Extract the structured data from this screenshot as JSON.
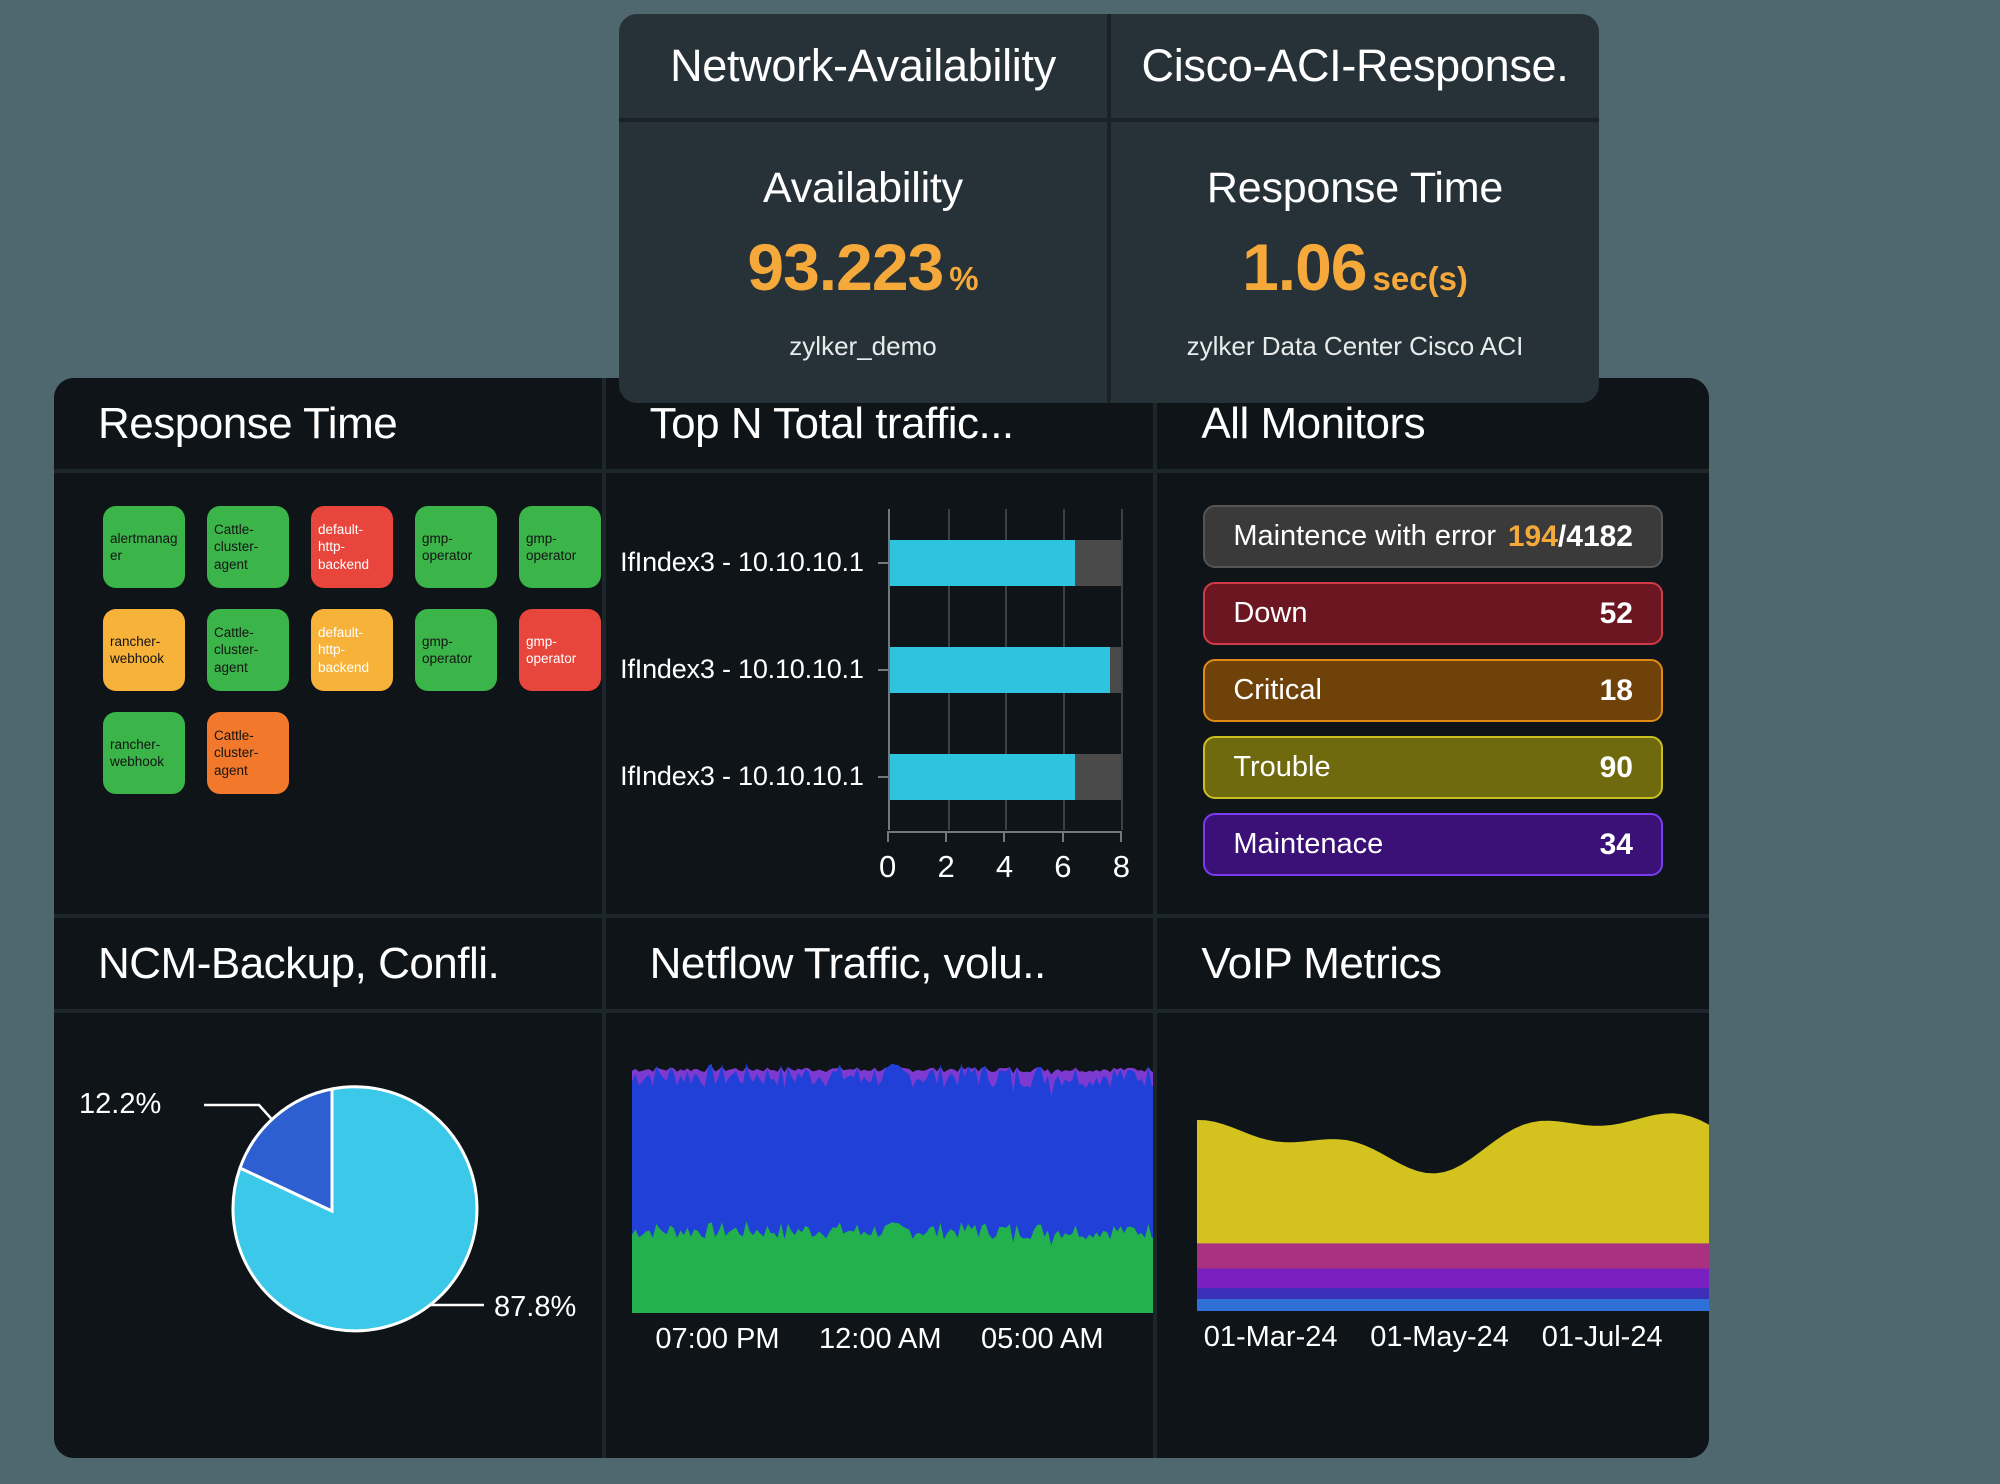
{
  "kpi_cards": [
    {
      "title": "Network-Availability",
      "metric": "Availability",
      "value": "93.223",
      "unit": "%",
      "subtitle": "zylker_demo"
    },
    {
      "title": "Cisco-ACI-Response.",
      "metric": "Response Time",
      "value": "1.06",
      "unit": "sec(s)",
      "subtitle": "zylker Data Center Cisco ACI"
    }
  ],
  "tiles": {
    "response_time": {
      "title": "Response Time",
      "badges": [
        {
          "label": "alertmanager",
          "color": "#3bb54a",
          "text": "dark"
        },
        {
          "label": "Cattle-cluster-agent",
          "color": "#3bb54a",
          "text": "dark"
        },
        {
          "label": "default-http-backend",
          "color": "#e8453c",
          "text": "light"
        },
        {
          "label": "gmp-operator",
          "color": "#3bb54a",
          "text": "dark"
        },
        {
          "label": "gmp-operator",
          "color": "#3bb54a",
          "text": "dark"
        },
        {
          "label": "rancher-webhook",
          "color": "#f7b239",
          "text": "dark"
        },
        {
          "label": "Cattle-cluster-agent",
          "color": "#3bb54a",
          "text": "dark"
        },
        {
          "label": "default-http-backend",
          "color": "#f7b239",
          "text": "light"
        },
        {
          "label": "gmp-operator",
          "color": "#3bb54a",
          "text": "dark"
        },
        {
          "label": "gmp-operator",
          "color": "#e8453c",
          "text": "light"
        },
        {
          "label": "rancher-webhook",
          "color": "#3bb54a",
          "text": "dark"
        },
        {
          "label": "Cattle-cluster-agent",
          "color": "#f2792b",
          "text": "dark"
        }
      ]
    },
    "top_n_traffic": {
      "title": "Top N Total traffic..."
    },
    "all_monitors": {
      "title": "All Monitors",
      "rows": [
        {
          "label": "Maintence with error",
          "value_accent": "194",
          "value_rest": "/4182",
          "bg": "#3a3a3a",
          "border": "#555555"
        },
        {
          "label": "Down",
          "value_accent": "",
          "value_rest": "52",
          "bg": "#6b1620",
          "border": "#d13b47"
        },
        {
          "label": "Critical",
          "value_accent": "",
          "value_rest": "18",
          "bg": "#6e4208",
          "border": "#e08b14"
        },
        {
          "label": "Trouble",
          "value_accent": "",
          "value_rest": "90",
          "bg": "#6f6a0d",
          "border": "#c9c020"
        },
        {
          "label": "Maintenace",
          "value_accent": "",
          "value_rest": "34",
          "bg": "#3b1178",
          "border": "#7a3cf0"
        }
      ]
    },
    "ncm_backup": {
      "title": "NCM-Backup, Confli."
    },
    "netflow": {
      "title": "Netflow Traffic, volu.."
    },
    "voip": {
      "title": "VoIP Metrics"
    }
  },
  "chart_data": [
    {
      "type": "bar",
      "title": "Top N Total traffic...",
      "orientation": "horizontal",
      "categories": [
        "IfIndex3 - 10.10.10.1",
        "IfIndex3 - 10.10.10.1",
        "IfIndex3 - 10.10.10.1"
      ],
      "values": [
        6.4,
        7.6,
        6.4
      ],
      "track_values": [
        8.0,
        8.0,
        8.0
      ],
      "xlabel": "",
      "ylabel": "",
      "xlim": [
        0,
        8
      ],
      "xticks": [
        0,
        2,
        4,
        6,
        8
      ],
      "tick_labels": [
        "0",
        "2",
        "4",
        "6",
        "8"
      ],
      "grid": true,
      "series_color": "#2ec4e0",
      "track_color": "#4a4a4a"
    },
    {
      "type": "pie",
      "title": "NCM-Backup, Confli.",
      "labels": [
        "12.2%",
        "87.8%"
      ],
      "values": [
        12.2,
        87.8
      ],
      "colors": [
        "#2e5fd0",
        "#3cc8e8"
      ],
      "label_positions": [
        "upper-left",
        "lower-right"
      ]
    },
    {
      "type": "area",
      "title": "Netflow Traffic, volu..",
      "stacked": true,
      "x_tick_labels": [
        "07:00 PM",
        "12:00 AM",
        "05:00 AM"
      ],
      "series": [
        {
          "name": "series-green",
          "color": "#22b14c",
          "approx_share": 0.33
        },
        {
          "name": "series-blue",
          "color": "#2040d8",
          "approx_share": 0.62
        },
        {
          "name": "series-purple",
          "color": "#7c3ad0",
          "approx_share": 0.05
        }
      ],
      "grid": false
    },
    {
      "type": "area",
      "title": "VoIP Metrics",
      "stacked": true,
      "x_tick_labels": [
        "01-Mar-24",
        "01-May-24",
        "01-Jul-24"
      ],
      "series": [
        {
          "name": "band-blue",
          "color": "#2f6fd8",
          "approx_share": 0.05
        },
        {
          "name": "band-indigo",
          "color": "#3b2fb8",
          "approx_share": 0.06
        },
        {
          "name": "band-violet",
          "color": "#7b20c0",
          "approx_share": 0.1
        },
        {
          "name": "band-magenta",
          "color": "#a8327f",
          "approx_share": 0.12
        },
        {
          "name": "band-yellow",
          "color": "#d4c21e",
          "approx_share": 0.67
        }
      ],
      "grid": false
    }
  ]
}
